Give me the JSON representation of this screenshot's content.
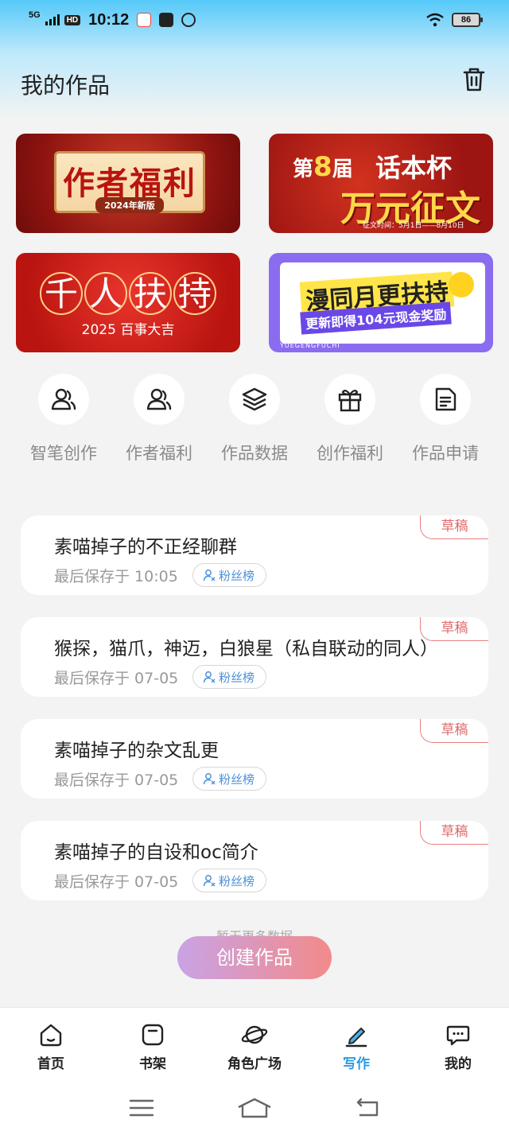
{
  "status_bar": {
    "network": "5G",
    "hd": "HD",
    "time": "10:12",
    "battery": "86"
  },
  "header": {
    "title": "我的作品"
  },
  "banners": [
    {
      "line1": "作者福利",
      "line2": "2024年新版"
    },
    {
      "prefix": "第",
      "number": "8",
      "suffix": "届",
      "line2": "话本杯",
      "line3": "万元征文",
      "line4": "征文时间：5月1日——8月10日"
    },
    {
      "line1": [
        "千",
        "人",
        "扶",
        "持"
      ],
      "line2": "2025 百事大吉"
    },
    {
      "line1": "漫同月更扶持",
      "line2": "更新即得104元现金奖励",
      "line3": "YUEGENGFUCHI"
    }
  ],
  "quick_actions": [
    {
      "label": "智笔创作",
      "icon": "user-pen-icon"
    },
    {
      "label": "作者福利",
      "icon": "users-icon"
    },
    {
      "label": "作品数据",
      "icon": "layers-icon"
    },
    {
      "label": "创作福利",
      "icon": "gift-icon"
    },
    {
      "label": "作品申请",
      "icon": "document-icon"
    }
  ],
  "works": [
    {
      "title": "素喵掉子的不正经聊群",
      "saved": "最后保存于 10:05",
      "fans": "粉丝榜",
      "status": "草稿"
    },
    {
      "title": "猴探，猫爪，神迈，白狼星（私自联动的同人）",
      "saved": "最后保存于 07-05",
      "fans": "粉丝榜",
      "status": "草稿"
    },
    {
      "title": "素喵掉子的杂文乱更",
      "saved": "最后保存于 07-05",
      "fans": "粉丝榜",
      "status": "草稿"
    },
    {
      "title": "素喵掉子的自设和oc简介",
      "saved": "最后保存于 07-05",
      "fans": "粉丝榜",
      "status": "草稿"
    }
  ],
  "footer_text": "暂无更多数据",
  "create_button": "创建作品",
  "bottom_nav": [
    {
      "label": "首页",
      "icon": "home-icon"
    },
    {
      "label": "书架",
      "icon": "bookshelf-icon"
    },
    {
      "label": "角色广场",
      "icon": "planet-icon"
    },
    {
      "label": "写作",
      "icon": "pen-icon",
      "active": true
    },
    {
      "label": "我的",
      "icon": "chat-icon"
    }
  ],
  "colors": {
    "accent": "#2b9be0",
    "draft_badge": "#e06a6a",
    "create_gradient_start": "#c9a3e6",
    "create_gradient_end": "#f28a8a"
  }
}
